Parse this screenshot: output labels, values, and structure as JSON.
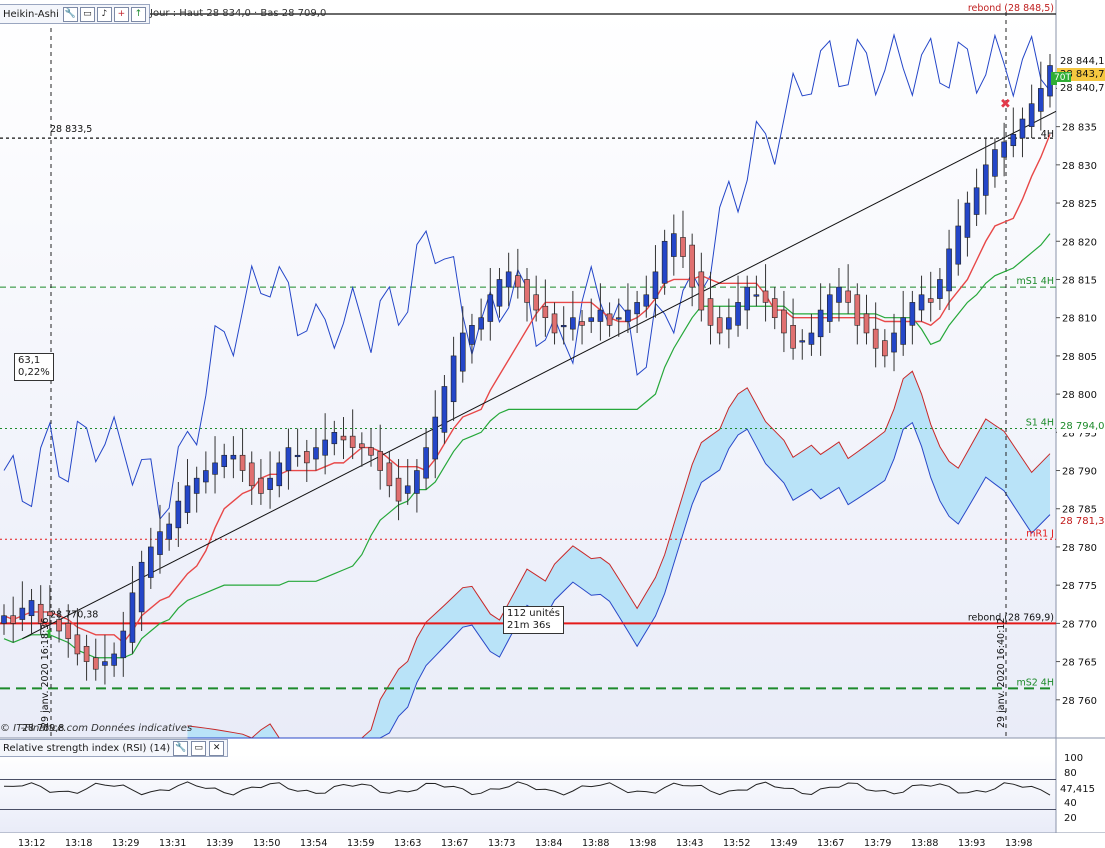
{
  "toolbar": {
    "title": "Heikin-Ashi",
    "info": "Jour : Haut 28 834,0 · Bas 28 709,0"
  },
  "rsi_toolbar": {
    "title": "Relative strength index (RSI) (14)"
  },
  "credit": "© IT-Finance.com  Données indicatives",
  "annotations": {
    "left_box_value": "63,1",
    "left_box_pct": "0,22%",
    "level_label": "28 833,5",
    "left_price_label": "28 770,38",
    "left_date_tag": "28 769,8",
    "units_box_line1": "112 unités",
    "units_box_line2": "21m 36s",
    "date_left": "29 janv. 2020 16:18:36",
    "date_right": "29 janv. 2020 16:40:12",
    "rebound_top": "rebond (28 848,5)",
    "rebound_bottom": "rebond (28 769,9)",
    "ms1": "mS1 4H",
    "s1": "S1 4H",
    "mr1": "mR1 J",
    "ms2": "mS2 4H",
    "h4": "4H"
  },
  "price_tags": {
    "last_high": "28 844,1",
    "current": "28 843,7",
    "prev": "28 840,7",
    "s1": "28 794,0",
    "mr1": "28 781,3",
    "contracts": "70T",
    "rsi_value": "47,415"
  },
  "colors": {
    "bull": "#2446c8",
    "bear": "#e07070",
    "tenkan": "#e84848",
    "kijun": "#26a83a",
    "chikou": "#2446c8",
    "cloud": "#b9e3f8",
    "resistance": "#e41a1a",
    "support": "#1c8a2a"
  },
  "chart_data": {
    "type": "candlestick",
    "y_axis": {
      "min": 28755,
      "max": 28850,
      "ticks": [
        28760,
        28765,
        28770,
        28775,
        28780,
        28785,
        28790,
        28795,
        28800,
        28805,
        28810,
        28815,
        28820,
        28825,
        28830,
        28835,
        28840
      ],
      "tick_labels": [
        "28 760",
        "28 765",
        "28 770",
        "28 775",
        "28 780",
        "28 785",
        "28 790",
        "28 795",
        "28 800",
        "28 805",
        "28 810",
        "28 815",
        "28 820",
        "28 825",
        "28 830",
        "28 835",
        "28 840"
      ]
    },
    "levels": {
      "horizontal_dashed": 28833.5,
      "rebond_low": 28770,
      "ms2": 28761.5,
      "ms1": 28814,
      "s1": 28795.5,
      "mr1": 28781
    },
    "close_series": [
      28771,
      28770,
      28772,
      28773,
      28770,
      28771,
      28769,
      28768,
      28766,
      28765,
      28764,
      28765,
      28766,
      28769,
      28774,
      28778,
      28780,
      28782,
      28783,
      28786,
      28788,
      28789,
      28790,
      28791,
      28792,
      28792,
      28790,
      28788,
      28787,
      28789,
      28791,
      28793,
      28792,
      28791,
      28793,
      28794,
      28795,
      28794,
      28793,
      28793,
      28792,
      28790,
      28788,
      28786,
      28788,
      28790,
      28793,
      28797,
      28801,
      28805,
      28808,
      28809,
      28810,
      28813,
      28815,
      28816,
      28814,
      28812,
      28811,
      28810,
      28808,
      28809,
      28810,
      28809,
      28810,
      28811,
      28809,
      28810,
      28811,
      28812,
      28813,
      28816,
      28820,
      28821,
      28818,
      28814,
      28811,
      28809,
      28808,
      28810,
      28812,
      28814,
      28813,
      28812,
      28810,
      28808,
      28806,
      28807,
      28808,
      28811,
      28813,
      28814,
      28812,
      28809,
      28808,
      28806,
      28805,
      28808,
      28810,
      28812,
      28813,
      28812,
      28815,
      28819,
      28822,
      28825,
      28827,
      28830,
      28832,
      28833,
      28834,
      28836,
      28838,
      28840,
      28843
    ],
    "rsi": {
      "min": 0,
      "max": 100,
      "ticks": [
        20,
        40,
        60,
        80,
        100
      ],
      "value": 47.415
    },
    "x_axis_labels": [
      "13:12",
      "13:18",
      "13:29",
      "13:31",
      "13:39",
      "13:50",
      "13:54",
      "13:59",
      "13:63",
      "13:67",
      "13:73",
      "13:84",
      "13:88",
      "13:98",
      "13:43",
      "13:52",
      "13:49",
      "13:67",
      "13:79",
      "13:88",
      "13:93",
      "13:98"
    ]
  }
}
